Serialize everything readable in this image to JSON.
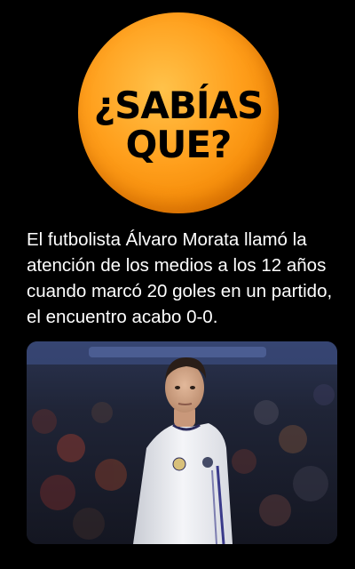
{
  "badge": {
    "line1": "¿SABÍAS",
    "line2": "QUE?",
    "color": "#ff9f1c"
  },
  "post": {
    "text": "El futbolista Álvaro Morata llamó la atención de los medios a los 12 años cuando marcó 20 goles en un partido, el encuentro acabo 0-0."
  },
  "photo": {
    "subject": "football player in white jersey"
  }
}
